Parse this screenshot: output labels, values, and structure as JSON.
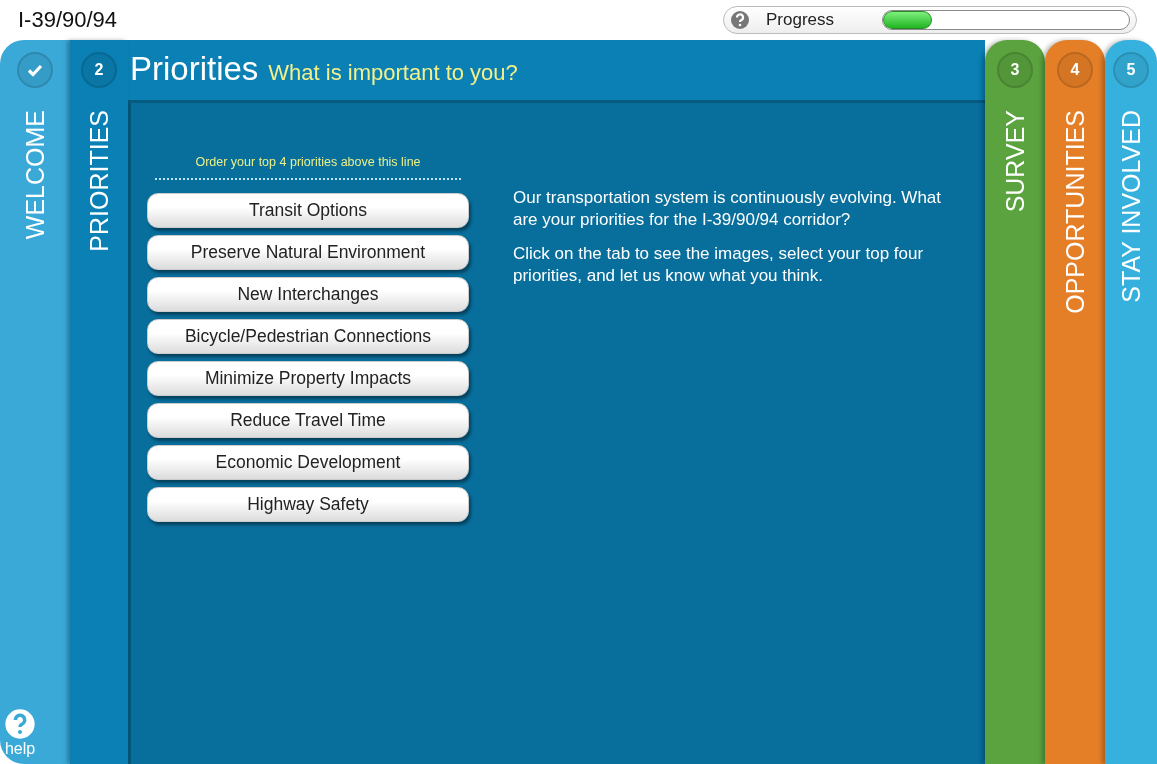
{
  "header": {
    "title": "I-39/90/94",
    "progress": {
      "label": "Progress",
      "level": 0.2
    }
  },
  "steps": [
    {
      "label": "WELCOME",
      "completed": true,
      "selected": false,
      "color": "#3aa9d8"
    },
    {
      "number": "2",
      "label": "PRIORITIES",
      "completed": false,
      "selected": true,
      "color": "#0a80b4"
    },
    {
      "number": "3",
      "label": "SURVEY",
      "completed": false,
      "selected": false,
      "color": "#5aa33e"
    },
    {
      "number": "4",
      "label": "OPPORTUNITIES",
      "completed": false,
      "selected": false,
      "color": "#e57f27"
    },
    {
      "number": "5",
      "label": "STAY INVOLVED",
      "completed": false,
      "selected": false,
      "color": "#36b1dd"
    }
  ],
  "help": {
    "label": "help"
  },
  "page": {
    "title": "Priorities",
    "subtitle": "What is important to you?",
    "instruction": "Order your top 4 priorities above this line",
    "priorities": [
      "Transit Options",
      "Preserve Natural Environment",
      "New Interchanges",
      "Bicycle/Pedestrian Connections",
      "Minimize Property Impacts",
      "Reduce Travel Time",
      "Economic Development",
      "Highway Safety"
    ],
    "paragraphs": [
      "Our transportation system is continuously evolving. What are your priorities for the I-39/90/94 corridor?",
      "Click on the tab to see the images, select your top four priorities, and let us know what you think."
    ]
  }
}
